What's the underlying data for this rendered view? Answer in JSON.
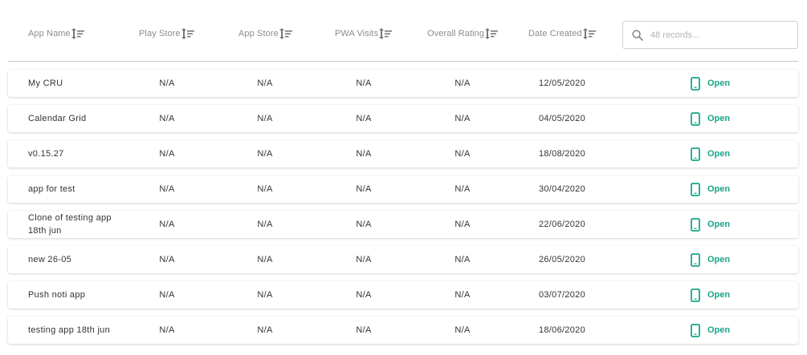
{
  "columns": {
    "app_name": "App Name",
    "play_store": "Play Store",
    "app_store": "App Store",
    "pwa_visits": "PWA Visits",
    "overall_rating": "Overall Rating",
    "date_created": "Date Created"
  },
  "search": {
    "placeholder": "48 records..."
  },
  "colors": {
    "accent": "#17a589",
    "header_text": "#8c8c8c"
  },
  "icons": {
    "sort": "sort-icon",
    "search": "search-icon",
    "phone": "mobile-phone-icon"
  },
  "rows": [
    {
      "name": "My CRU",
      "play_store": "N/A",
      "app_store": "N/A",
      "pwa_visits": "N/A",
      "rating": "N/A",
      "date": "12/05/2020",
      "action": "Open"
    },
    {
      "name": "Calendar Grid",
      "play_store": "N/A",
      "app_store": "N/A",
      "pwa_visits": "N/A",
      "rating": "N/A",
      "date": "04/05/2020",
      "action": "Open"
    },
    {
      "name": "v0.15.27",
      "play_store": "N/A",
      "app_store": "N/A",
      "pwa_visits": "N/A",
      "rating": "N/A",
      "date": "18/08/2020",
      "action": "Open"
    },
    {
      "name": "app for test",
      "play_store": "N/A",
      "app_store": "N/A",
      "pwa_visits": "N/A",
      "rating": "N/A",
      "date": "30/04/2020",
      "action": "Open"
    },
    {
      "name": "Clone of testing app 18th jun",
      "play_store": "N/A",
      "app_store": "N/A",
      "pwa_visits": "N/A",
      "rating": "N/A",
      "date": "22/06/2020",
      "action": "Open"
    },
    {
      "name": "new 26-05",
      "play_store": "N/A",
      "app_store": "N/A",
      "pwa_visits": "N/A",
      "rating": "N/A",
      "date": "26/05/2020",
      "action": "Open"
    },
    {
      "name": "Push noti app",
      "play_store": "N/A",
      "app_store": "N/A",
      "pwa_visits": "N/A",
      "rating": "N/A",
      "date": "03/07/2020",
      "action": "Open"
    },
    {
      "name": "testing app 18th jun",
      "play_store": "N/A",
      "app_store": "N/A",
      "pwa_visits": "N/A",
      "rating": "N/A",
      "date": "18/06/2020",
      "action": "Open"
    }
  ]
}
